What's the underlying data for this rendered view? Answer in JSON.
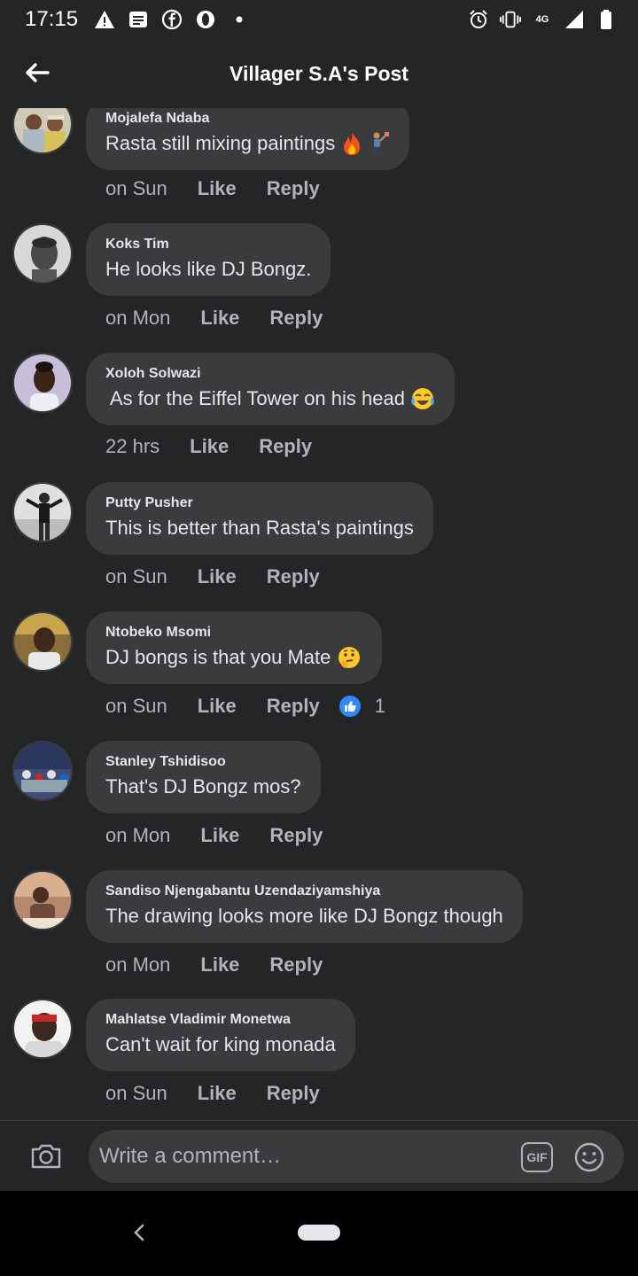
{
  "status_bar": {
    "time": "17:15",
    "network": "4G",
    "left_icons": [
      "warning-icon",
      "message-icon",
      "facebook-icon",
      "opera-icon",
      "dot-icon"
    ],
    "right_icons": [
      "alarm-icon",
      "vibrate-icon",
      "network-icon",
      "signal-icon",
      "battery-icon"
    ]
  },
  "header": {
    "title": "Villager S.A's Post",
    "back_icon": "arrow-left-icon"
  },
  "comments": [
    {
      "author": "Mojalefa Ndaba",
      "text": "Rasta still mixing paintings",
      "emojis": [
        "fire",
        "person-painting"
      ],
      "time": "on Sun",
      "like": "Like",
      "reply": "Reply"
    },
    {
      "author": "Koks Tim",
      "text": "He looks like DJ Bongz.",
      "time": "on Mon",
      "like": "Like",
      "reply": "Reply"
    },
    {
      "author": "Xoloh Solwazi",
      "text": " As for the Eiffel Tower on his head",
      "emojis": [
        "tears-of-joy"
      ],
      "time": "22 hrs",
      "like": "Like",
      "reply": "Reply"
    },
    {
      "author": "Putty Pusher",
      "text": "This is better than Rasta's paintings",
      "time": "on Sun",
      "like": "Like",
      "reply": "Reply"
    },
    {
      "author": "Ntobeko Msomi",
      "text": "DJ bongs is that you Mate",
      "emojis": [
        "thinking"
      ],
      "time": "on Sun",
      "like": "Like",
      "reply": "Reply",
      "reaction_icon": "thumbs-up-icon",
      "reaction_count": "1"
    },
    {
      "author": "Stanley Tshidisoo",
      "text": "That's DJ Bongz mos?",
      "time": "on Mon",
      "like": "Like",
      "reply": "Reply"
    },
    {
      "author": "Sandiso Njengabantu Uzendaziyamshiya",
      "text": "The drawing looks more like DJ Bongz though",
      "time": "on Mon",
      "like": "Like",
      "reply": "Reply"
    },
    {
      "author": "Mahlatse Vladimir Monetwa",
      "text": "Can't wait for king monada",
      "time": "on Sun",
      "like": "Like",
      "reply": "Reply"
    }
  ],
  "composer": {
    "placeholder": "Write a comment…",
    "gif_label": "GIF",
    "camera_icon": "camera-icon",
    "emoji_icon": "emoji-icon"
  },
  "nav_bar": {
    "back_icon": "chevron-left-icon",
    "home_icon": "home-pill-icon"
  },
  "colors": {
    "background": "#242526",
    "bubble": "#3a3b3c",
    "text": "#e4e6eb",
    "secondary_text": "#b0b3b8",
    "reaction_blue": "#2e89ff"
  }
}
